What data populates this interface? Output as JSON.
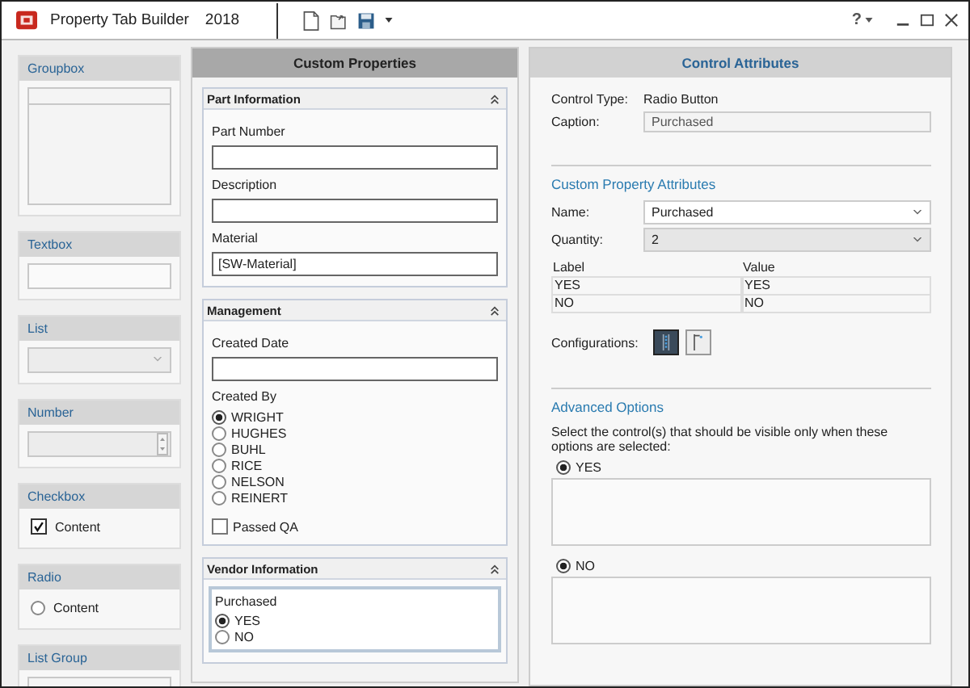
{
  "window": {
    "title": "Property Tab Builder",
    "version": "2018",
    "help": "?"
  },
  "palette": [
    {
      "kind": "groupbox",
      "title": "Groupbox"
    },
    {
      "kind": "textbox",
      "title": "Textbox"
    },
    {
      "kind": "list",
      "title": "List"
    },
    {
      "kind": "number",
      "title": "Number"
    },
    {
      "kind": "checkbox",
      "title": "Checkbox",
      "label": "Content",
      "checked": true
    },
    {
      "kind": "radio",
      "title": "Radio",
      "label": "Content",
      "checked": false
    },
    {
      "kind": "listgroup",
      "title": "List Group"
    }
  ],
  "custom_properties": {
    "title": "Custom Properties",
    "groups": [
      {
        "title": "Part Information",
        "fields": [
          {
            "kind": "text",
            "label": "Part Number",
            "selected": false
          },
          {
            "kind": "text",
            "label": "Description",
            "selected": false
          },
          {
            "kind": "text",
            "label": "Material",
            "value": "[SW-Material]",
            "selected": false
          }
        ]
      },
      {
        "title": "Management",
        "fields": [
          {
            "kind": "text",
            "label": "Created Date",
            "selected": false
          },
          {
            "kind": "radio",
            "label": "Created By",
            "selected": false,
            "options": [
              {
                "label": "WRIGHT",
                "selected": true
              },
              {
                "label": "HUGHES",
                "selected": false
              },
              {
                "label": "BUHL",
                "selected": false
              },
              {
                "label": "RICE",
                "selected": false
              },
              {
                "label": "NELSON",
                "selected": false
              },
              {
                "label": "REINERT",
                "selected": false
              }
            ]
          },
          {
            "kind": "checkbox",
            "label": "Passed QA",
            "checked": false,
            "selected": false
          }
        ]
      },
      {
        "title": "Vendor Information",
        "fields": [
          {
            "kind": "radio",
            "label": "Purchased",
            "selected": true,
            "options": [
              {
                "label": "YES",
                "selected": true
              },
              {
                "label": "NO",
                "selected": false
              }
            ]
          }
        ]
      }
    ]
  },
  "control_attributes": {
    "title": "Control Attributes",
    "control_type": {
      "label": "Control Type:",
      "value": "Radio Button"
    },
    "caption": {
      "label": "Caption:",
      "value": "Purchased"
    },
    "section_title": "Custom Property Attributes",
    "name": {
      "label": "Name:",
      "value": "Purchased"
    },
    "quantity": {
      "label": "Quantity:",
      "value": "2"
    },
    "table": {
      "columns": [
        "Label",
        "Value"
      ],
      "rows": [
        [
          "YES",
          "YES"
        ],
        [
          "NO",
          "NO"
        ]
      ]
    },
    "configurations": {
      "label": "Configurations:",
      "buttons": [
        {
          "selected": true
        },
        {
          "selected": false
        }
      ]
    },
    "advanced": {
      "title": "Advanced Options",
      "description": "Select the control(s) that should be visible only when these options are selected:",
      "options": [
        {
          "label": "YES",
          "checked": true
        },
        {
          "label": "NO",
          "checked": true
        }
      ]
    }
  }
}
